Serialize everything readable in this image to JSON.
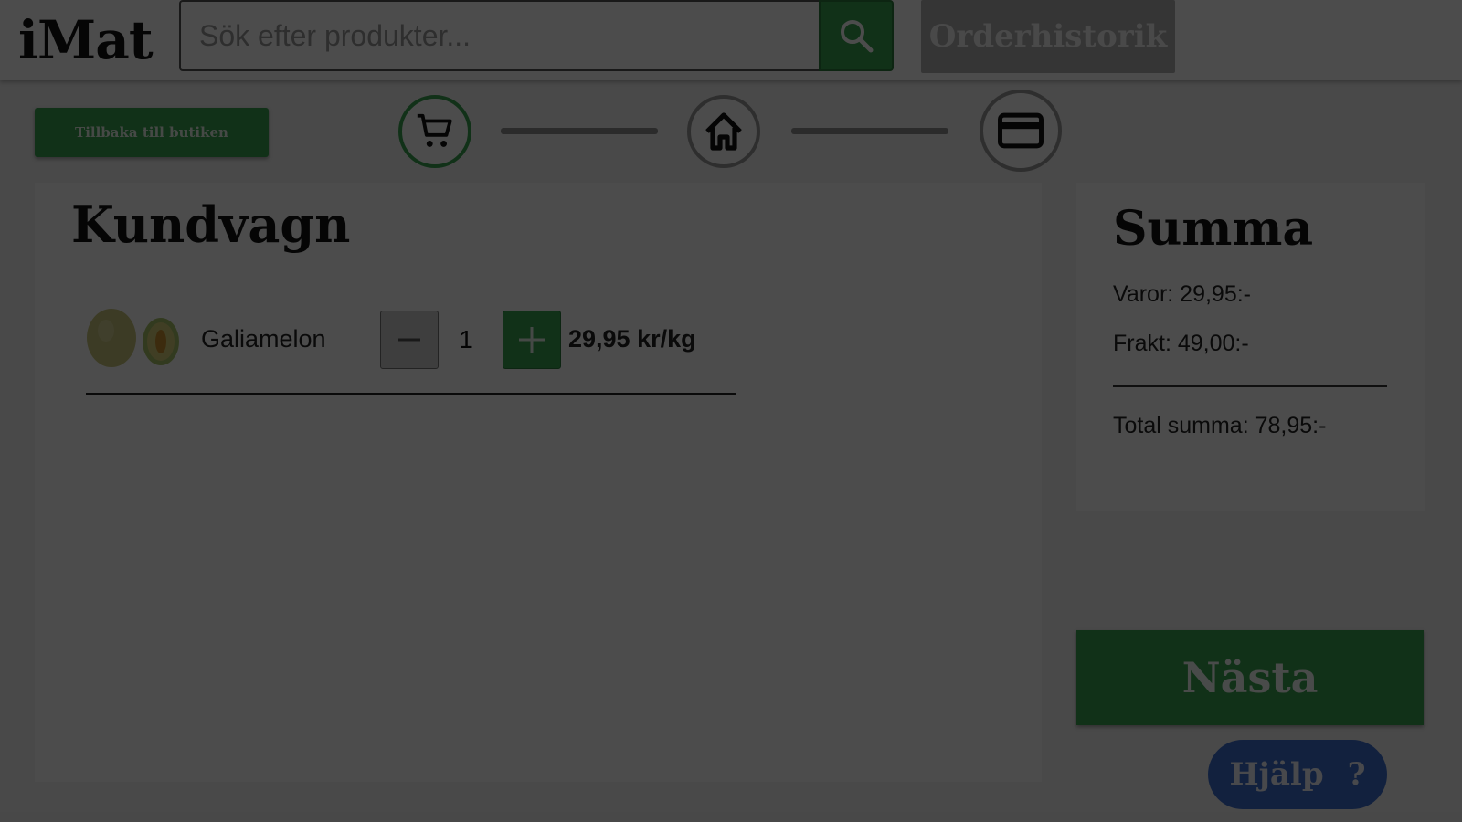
{
  "header": {
    "logo": "iMat",
    "search_placeholder": "Sök efter produkter...",
    "order_history_label": "Orderhistorik"
  },
  "navigation": {
    "back_label": "Tillbaka till butiken",
    "steps": [
      {
        "name": "cart",
        "icon": "cart-icon",
        "active": true
      },
      {
        "name": "delivery",
        "icon": "home-icon",
        "active": false
      },
      {
        "name": "payment",
        "icon": "credit-card-icon",
        "active": false
      }
    ]
  },
  "cart": {
    "title": "Kundvagn",
    "items": [
      {
        "name": "Galiamelon",
        "quantity": "1",
        "price": "29,95 kr/kg"
      }
    ]
  },
  "summary": {
    "title": "Summa",
    "goods": "Varor: 29,95:-",
    "shipping": "Frakt: 49,00:-",
    "total": "Total summa: 78,95:-"
  },
  "actions": {
    "next_label": "Nästa",
    "help_label": "Hjälp",
    "help_symbol": "?"
  },
  "colors": {
    "accent": "#3aa451",
    "help": "#3e6fd1",
    "disabled": "#b3b3b3",
    "overlay": "rgba(0,0,0,0.7)"
  }
}
